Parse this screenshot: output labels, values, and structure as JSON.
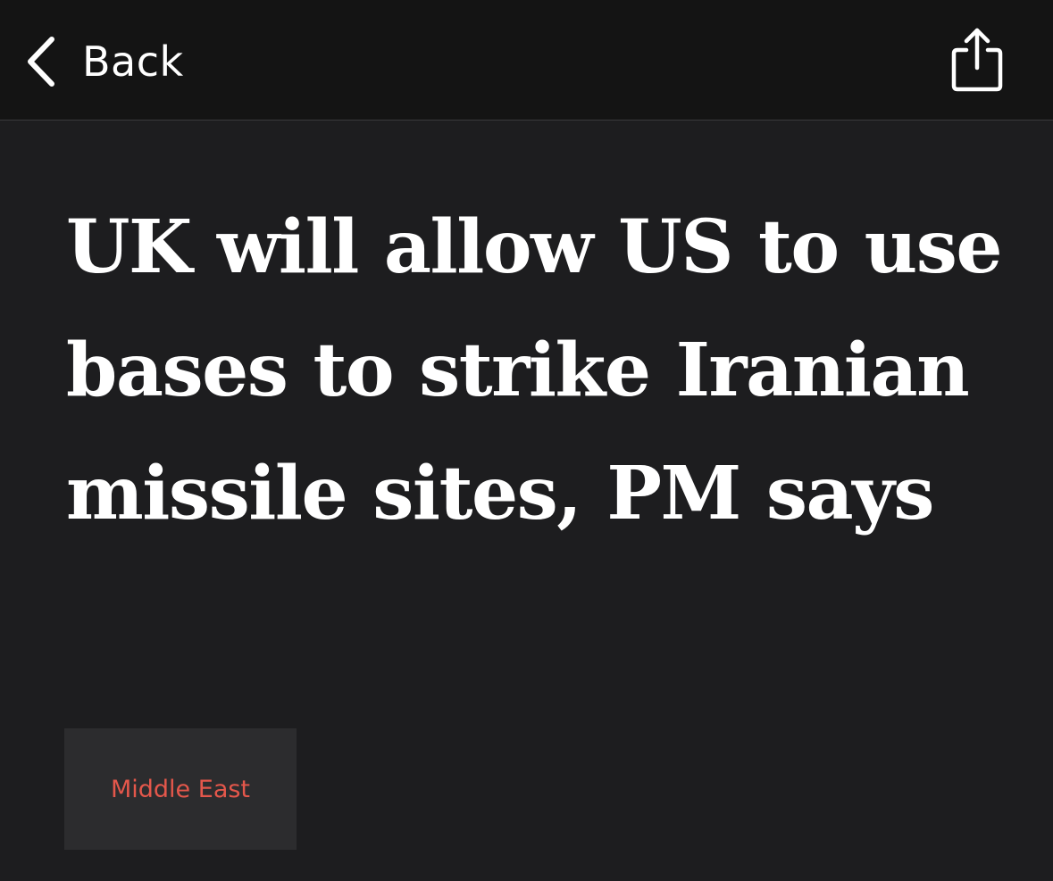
{
  "nav": {
    "back_label": "Back",
    "back_icon": "chevron-left-icon",
    "share_icon": "share-icon"
  },
  "article": {
    "headline": "UK will allow US to use bases to strike Iranian missile sites, PM says",
    "topic_tag": "Middle East"
  },
  "colors": {
    "background": "#1d1d1f",
    "top_bar": "#141414",
    "text": "#ffffff",
    "tag_background": "#2c2c2e",
    "tag_text": "#e4574b"
  }
}
